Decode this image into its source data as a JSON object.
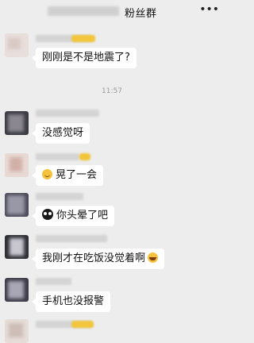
{
  "header": {
    "title": "粉丝群",
    "more_icon": "more-icon"
  },
  "timestamp": "11:57",
  "messages": [
    {
      "text": "刚刚是不是地震了?"
    },
    {
      "text": "没感觉呀"
    },
    {
      "text": "晃了一会",
      "emoji": "smile-emoji"
    },
    {
      "text": "你头晕了吧",
      "emoji": "owl-emoji"
    },
    {
      "text": "我刚才在吃饭没觉着啊",
      "emoji": "laugh-cry-emoji"
    },
    {
      "text": "手机也没报警"
    }
  ]
}
